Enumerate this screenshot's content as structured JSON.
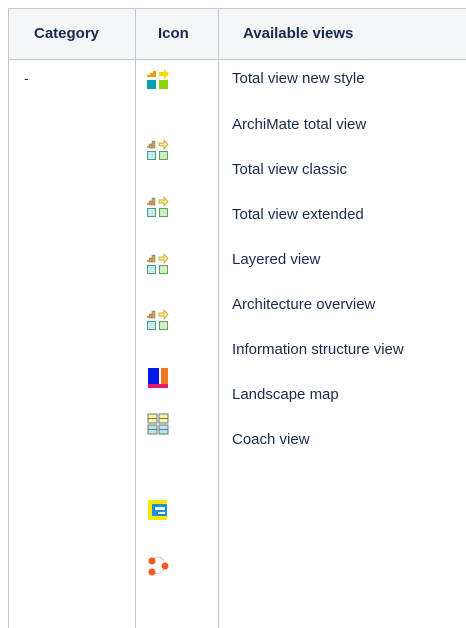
{
  "table": {
    "headers": {
      "category": "Category",
      "icon": "Icon",
      "views": "Available views"
    },
    "category_value": "-",
    "views": [
      "Total view new style",
      "ArchiMate total view",
      "Total view classic",
      "Total view extended",
      "Layered view",
      "Architecture overview",
      "Information structure view",
      "Landscape map",
      "Coach view"
    ],
    "icons": [
      "total-view-new-style-icon",
      "archimate-total-view-icon",
      "total-view-classic-icon",
      "total-view-extended-icon",
      "layered-view-icon",
      "landscape-map-icon",
      "grid-view-icon",
      "nested-view-icon",
      "coach-view-icon"
    ]
  },
  "colors": {
    "header_bg": "#f4f5f7",
    "border": "#c1c7d0",
    "text": "#172b4d"
  }
}
